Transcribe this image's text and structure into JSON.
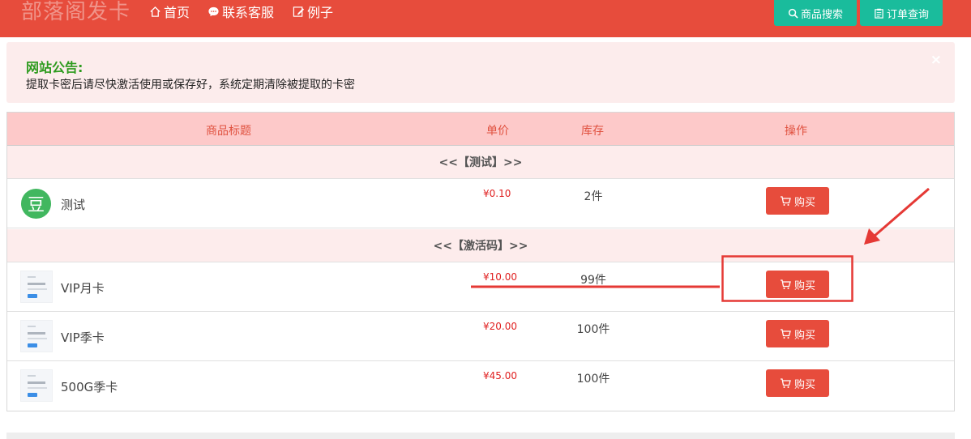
{
  "navbar": {
    "brand": "部落阁发卡",
    "links": [
      {
        "label": "首页",
        "icon": "home-icon"
      },
      {
        "label": "联系客服",
        "icon": "chat-icon"
      },
      {
        "label": "例子",
        "icon": "edit-icon"
      }
    ],
    "search_button": "商品搜索",
    "order_button": "订单查询"
  },
  "notice": {
    "title": "网站公告:",
    "text": "提取卡密后请尽快激活使用或保存好，系统定期清除被提取的卡密",
    "close": "×"
  },
  "table": {
    "headers": {
      "title": "商品标题",
      "price": "单价",
      "stock": "库存",
      "action": "操作"
    },
    "groups": [
      {
        "name": "<<【测试】>>",
        "products": [
          {
            "name": "测试",
            "price": "¥0.10",
            "stock": "2件",
            "buy": "购买",
            "thumb": "豆"
          }
        ]
      },
      {
        "name": "<<【激活码】>>",
        "products": [
          {
            "name": "VIP月卡",
            "price": "¥10.00",
            "stock": "99件",
            "buy": "购买"
          },
          {
            "name": "VIP季卡",
            "price": "¥20.00",
            "stock": "100件",
            "buy": "购买"
          },
          {
            "name": "500G季卡",
            "price": "¥45.00",
            "stock": "100件",
            "buy": "购买"
          }
        ]
      }
    ]
  },
  "colors": {
    "primary": "#e74c3c",
    "teal": "#1abc9c",
    "header_bg": "#fdc9c9",
    "annotation": "#e53935"
  }
}
